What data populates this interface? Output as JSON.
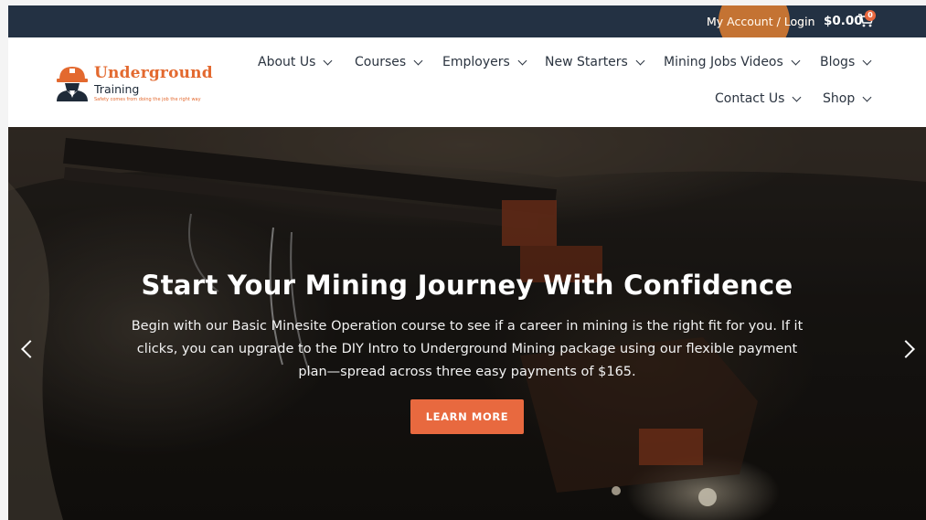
{
  "topbar": {
    "account_link": "My Account / Login",
    "cart_amount": "$0.00",
    "cart_count": "0",
    "cart_icon": "shopping-cart-icon"
  },
  "logo": {
    "title": "Underground",
    "subtitle": "Training",
    "tagline": "Safety comes from doing the job the right way",
    "icon": "miner-helmet-logo"
  },
  "nav": {
    "items": [
      {
        "label": "About Us"
      },
      {
        "label": "Courses"
      },
      {
        "label": "Employers"
      },
      {
        "label": "New Starters"
      },
      {
        "label": "Mining Jobs Videos"
      },
      {
        "label": "Blogs"
      },
      {
        "label": "Contact Us"
      },
      {
        "label": "Shop"
      }
    ],
    "chevron_icon": "chevron-down-icon"
  },
  "hero": {
    "title": "Start Your Mining Journey With Confidence",
    "text": "Begin with our Basic Minesite Operation course to see if a career in mining is the right fit for you. If it clicks, you can upgrade to the DIY Intro to Underground Mining package using our flexible payment plan—spread across three easy payments of $165.",
    "button_label": "LEARN MORE",
    "prev_icon": "chevron-left-icon",
    "next_icon": "chevron-right-icon"
  },
  "colors": {
    "topbar_bg": "#233143",
    "accent": "#e8693f",
    "nav_text": "#2b3440",
    "click_highlight": "#e88330"
  }
}
